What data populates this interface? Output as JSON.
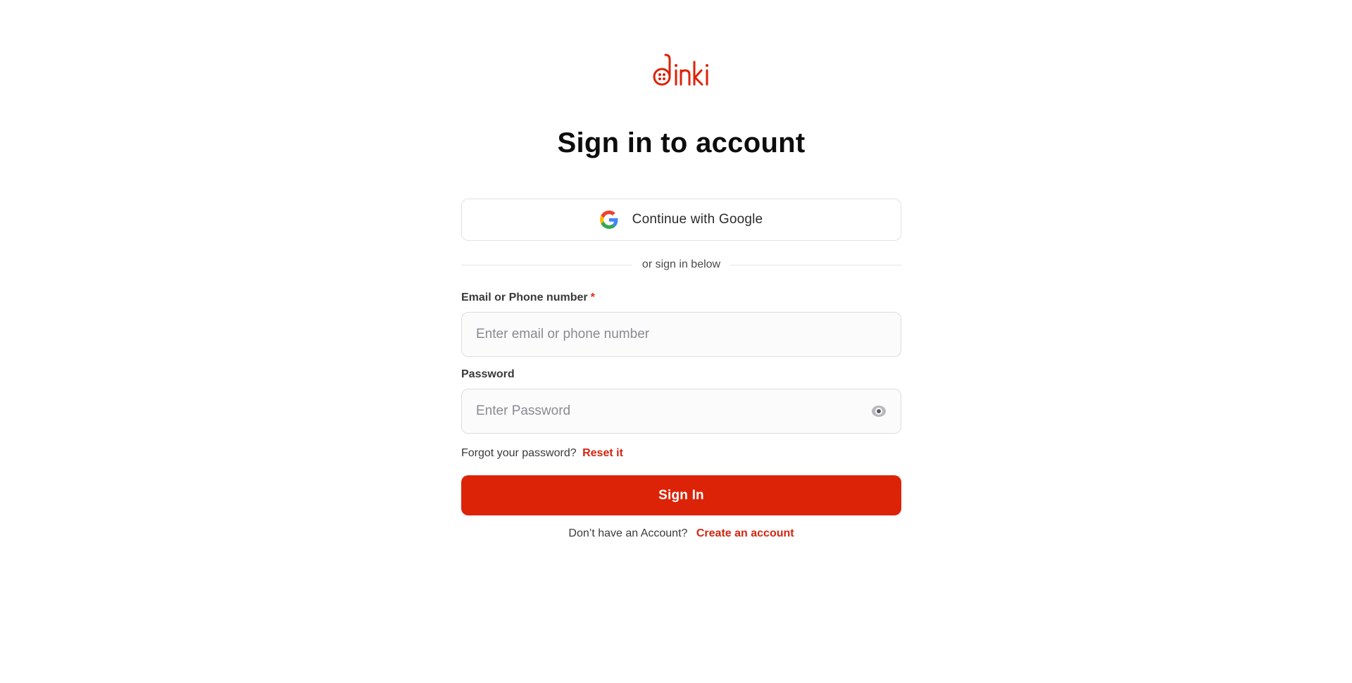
{
  "brand": {
    "logo_text": "dinki",
    "accent_color": "#dc2308"
  },
  "title": "Sign in to account",
  "google": {
    "label": "Continue with Google",
    "icon": "google-icon"
  },
  "divider_text": "or sign in below",
  "email_field": {
    "label": "Email or Phone number",
    "required_marker": "*",
    "placeholder": "Enter email or phone number",
    "value": ""
  },
  "password_field": {
    "label": "Password",
    "placeholder": "Enter Password",
    "value": "",
    "toggle_icon": "eye-icon"
  },
  "forgot": {
    "text": "Forgot your password?",
    "link": "Reset it"
  },
  "signin_button": "Sign In",
  "signup": {
    "text": "Don’t have an Account?",
    "link": "Create an account"
  }
}
